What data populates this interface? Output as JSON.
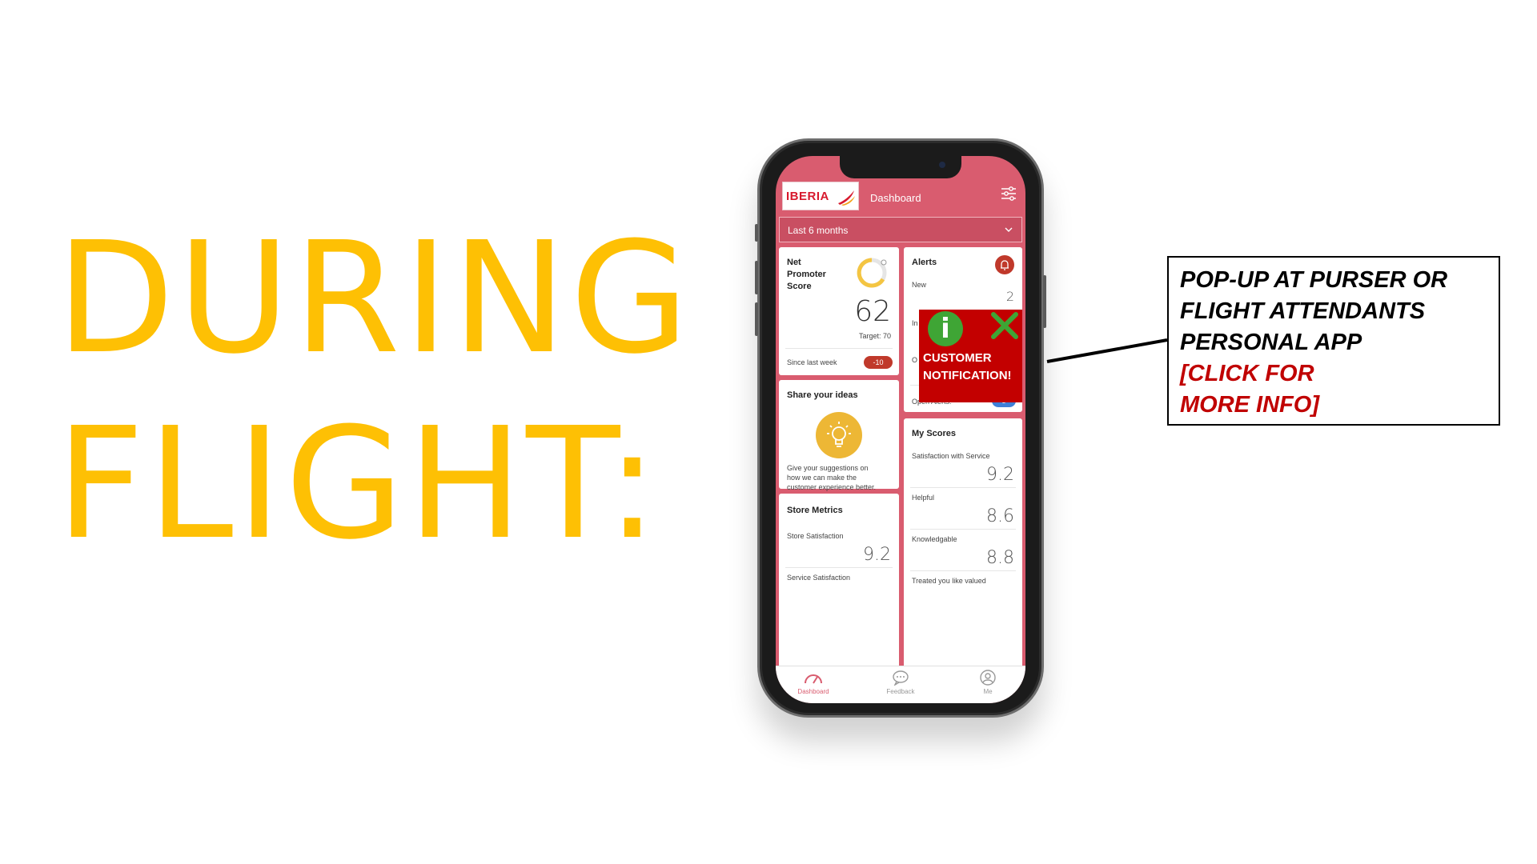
{
  "slide": {
    "title_line1": "DURING",
    "title_line2": "FLIGHT:"
  },
  "phone": {
    "brand": "IBERIA",
    "header_title": "Dashboard",
    "date_range": "Last 6 months",
    "nps": {
      "title_l1": "Net",
      "title_l2": "Promoter",
      "title_l3": "Score",
      "value": "62",
      "target": "Target: 70",
      "since_label": "Since last week",
      "delta": "-10"
    },
    "alerts": {
      "title": "Alerts",
      "new_label": "New",
      "new_value": "2",
      "in_label": "In",
      "o_label": "O",
      "open_label": "Open Alerts:",
      "open_value": "3"
    },
    "ideas": {
      "title": "Share your ideas",
      "desc_l1": "Give your suggestions on",
      "desc_l2": "how we can make the",
      "desc_l3": "customer experience better."
    },
    "my_scores": {
      "title": "My Scores",
      "items": [
        {
          "label": "Satisfaction with Service",
          "value": "9.2"
        },
        {
          "label": "Helpful",
          "value": "8.6"
        },
        {
          "label": "Knowledgable",
          "value": "8.8"
        },
        {
          "label": "Treated you like valued",
          "value": ""
        }
      ]
    },
    "store_metrics": {
      "title": "Store Metrics",
      "items": [
        {
          "label": "Store Satisfaction",
          "value": "9.2"
        },
        {
          "label": "Service Satisfaction",
          "value": ""
        }
      ]
    },
    "nav": [
      {
        "label": "Dashboard",
        "icon": "gauge-icon"
      },
      {
        "label": "Feedback",
        "icon": "chat-bubble-icon"
      },
      {
        "label": "Me",
        "icon": "user-icon"
      }
    ]
  },
  "popup": {
    "info_glyph": "i",
    "line1": "CUSTOMER",
    "line2": "NOTIFICATION!"
  },
  "callout": {
    "line1": "POP-UP AT PURSER OR",
    "line2": "FLIGHT ATTENDANTS",
    "line3": "PERSONAL APP",
    "link_line1": "[CLICK FOR",
    "link_line2": "MORE INFO]"
  },
  "colors": {
    "title": "#fec004",
    "app_accent": "#d95c6f",
    "popup_red": "#c30000",
    "info_green": "#3fa535",
    "link_red": "#c00000"
  }
}
